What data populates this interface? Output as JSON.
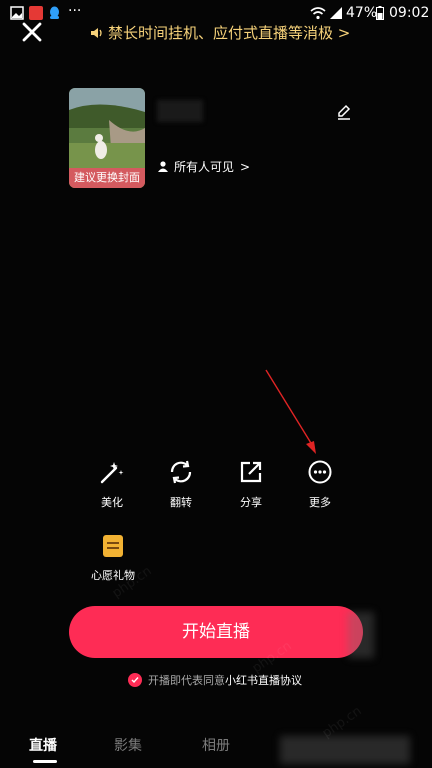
{
  "status_bar": {
    "battery": "47%",
    "time": "09:02",
    "overflow": "···"
  },
  "notice": {
    "text": "禁长时间挂机、应付式直播等消极",
    "chevron": ">"
  },
  "cover": {
    "label": "建议更换封面"
  },
  "visibility": {
    "text": "所有人可见",
    "chevron": ">"
  },
  "actions": [
    {
      "label": "美化",
      "icon": "beauty-wand-icon"
    },
    {
      "label": "翻转",
      "icon": "flip-camera-icon"
    },
    {
      "label": "分享",
      "icon": "share-icon"
    },
    {
      "label": "更多",
      "icon": "more-icon"
    }
  ],
  "gift": {
    "label": "心愿礼物",
    "icon": "wish-gift-icon"
  },
  "start_button": {
    "label": "开始直播"
  },
  "agreement": {
    "prefix": "开播即代表同意",
    "link": "小红书直播协议"
  },
  "tabs": [
    {
      "label": "直播",
      "active": true
    },
    {
      "label": "影集",
      "active": false
    },
    {
      "label": "相册",
      "active": false
    }
  ],
  "colors": {
    "primary": "#fe2c55",
    "notice": "#f6d27a",
    "background": "#050505"
  }
}
